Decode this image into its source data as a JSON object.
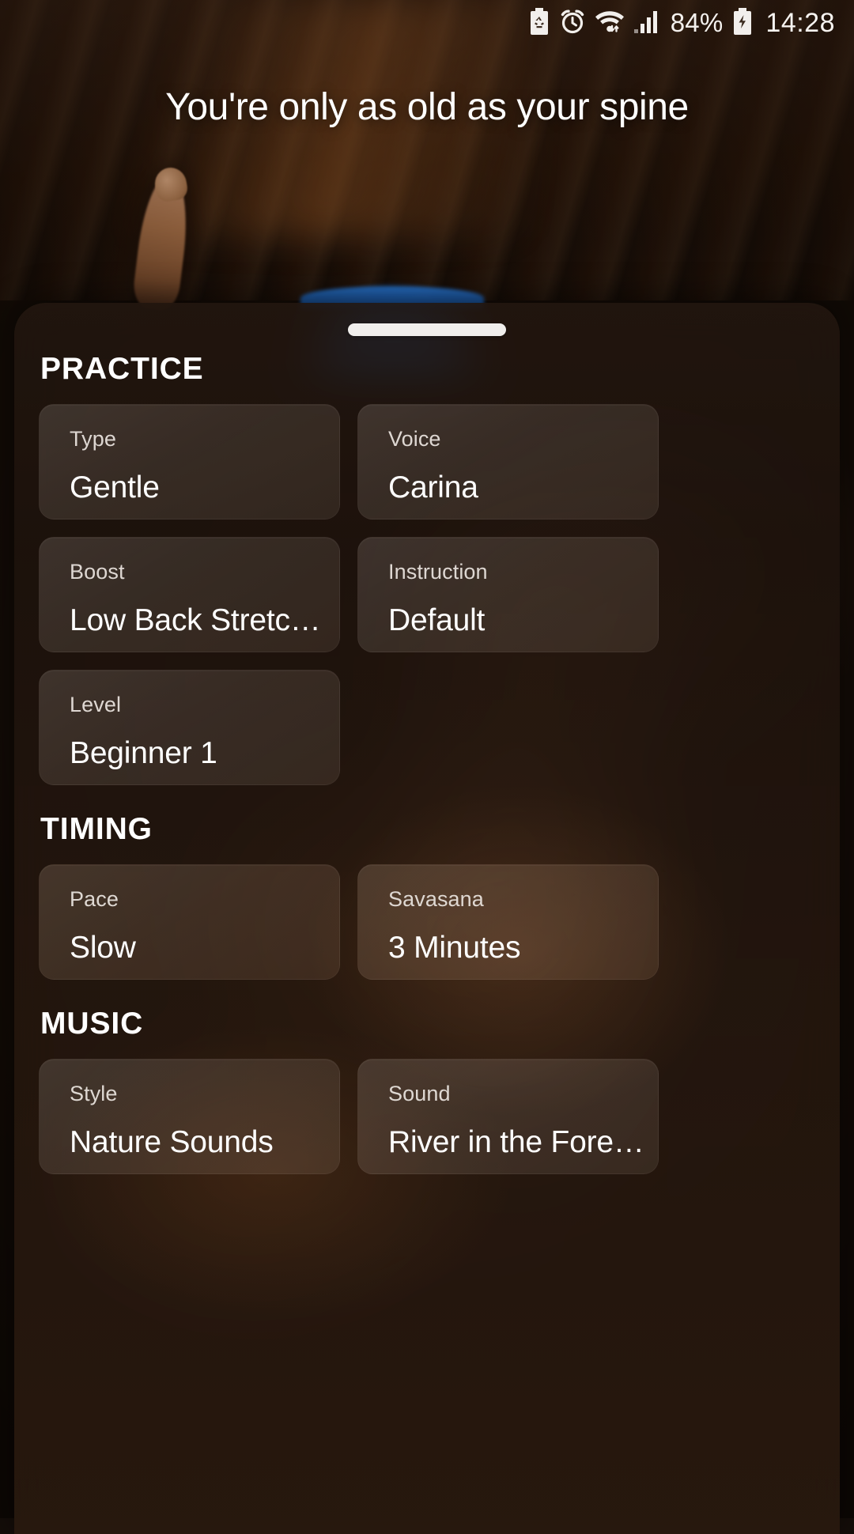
{
  "status_bar": {
    "icons": [
      {
        "name": "battery-saver-icon",
        "glyph": "battery-saver"
      },
      {
        "name": "alarm-icon",
        "glyph": "alarm"
      },
      {
        "name": "wifi-icon",
        "glyph": "wifi"
      },
      {
        "name": "cellular-signal-icon",
        "glyph": "signal"
      }
    ],
    "battery_percent": "84%",
    "battery_charging_icon": "battery-charging-icon",
    "clock": "14:28"
  },
  "hero": {
    "title": "You're only as old as your spine"
  },
  "sheet": {
    "handle": "drag-handle",
    "sections": [
      {
        "name": "practice",
        "title": "PRACTICE",
        "cards": [
          {
            "label": "Type",
            "value": "Gentle",
            "style": "cool"
          },
          {
            "label": "Voice",
            "value": "Carina",
            "style": "cool"
          },
          {
            "label": "Boost",
            "value": "Low Back Stretc…",
            "style": "cool"
          },
          {
            "label": "Instruction",
            "value": "Default",
            "style": "cool"
          },
          {
            "label": "Level",
            "value": "Beginner 1",
            "style": "cool"
          }
        ]
      },
      {
        "name": "timing",
        "title": "TIMING",
        "cards": [
          {
            "label": "Pace",
            "value": "Slow",
            "style": "warm"
          },
          {
            "label": "Savasana",
            "value": "3 Minutes",
            "style": "warm"
          }
        ]
      },
      {
        "name": "music",
        "title": "MUSIC",
        "cards": [
          {
            "label": "Style",
            "value": "Nature Sounds",
            "style": "cool"
          },
          {
            "label": "Sound",
            "value": "River in the Fore…",
            "style": "cool"
          }
        ]
      }
    ]
  },
  "colors": {
    "accent_mat": "#1f6fd0",
    "text_primary": "#ffffff",
    "text_secondary": "#e7e1dc",
    "sheet_bg": "#221609"
  }
}
